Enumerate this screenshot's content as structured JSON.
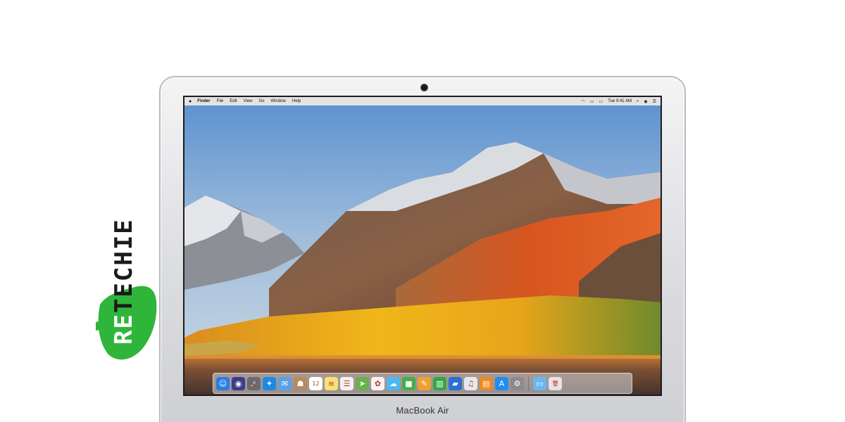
{
  "device": {
    "model_label": "MacBook Air"
  },
  "watermark": {
    "text": "RETECHIE",
    "brand_color": "#2fb53a"
  },
  "menubar": {
    "apple_icon": "apple-logo-icon",
    "items": [
      "Finder",
      "File",
      "Edit",
      "View",
      "Go",
      "Window",
      "Help"
    ],
    "status_icons": [
      "wifi-icon",
      "airplay-icon",
      "battery-icon"
    ],
    "clock": "Tue 9:41 AM",
    "right_icons": [
      "search-icon",
      "siri-icon",
      "notification-center-icon"
    ]
  },
  "dock": {
    "apps": [
      {
        "name": "finder",
        "color": "#2a7de1",
        "glyph": "☺"
      },
      {
        "name": "siri",
        "color": "#3c3c8c",
        "glyph": "◉"
      },
      {
        "name": "launchpad",
        "color": "#6a6a72",
        "glyph": "🚀"
      },
      {
        "name": "safari",
        "color": "#1e88e5",
        "glyph": "✦"
      },
      {
        "name": "mail",
        "color": "#5aa2e8",
        "glyph": "✉"
      },
      {
        "name": "contacts",
        "color": "#b38b5d",
        "glyph": "☗"
      },
      {
        "name": "calendar",
        "color": "#ffffff",
        "glyph": "12"
      },
      {
        "name": "notes",
        "color": "#f7e27a",
        "glyph": "≡"
      },
      {
        "name": "reminders",
        "color": "#f2f2f2",
        "glyph": "☰"
      },
      {
        "name": "maps",
        "color": "#6ab04c",
        "glyph": "➤"
      },
      {
        "name": "photos",
        "color": "#f5f5f5",
        "glyph": "✿"
      },
      {
        "name": "messages",
        "color": "#4cb8f0",
        "glyph": "☁"
      },
      {
        "name": "facetime",
        "color": "#3fb14c",
        "glyph": "■"
      },
      {
        "name": "pages",
        "color": "#f0a030",
        "glyph": "✎"
      },
      {
        "name": "numbers",
        "color": "#30a84a",
        "glyph": "▥"
      },
      {
        "name": "keynote",
        "color": "#2a6fd6",
        "glyph": "▰"
      },
      {
        "name": "itunes",
        "color": "#e8e8ee",
        "glyph": "♫"
      },
      {
        "name": "ibooks",
        "color": "#f08a1e",
        "glyph": "▤"
      },
      {
        "name": "app-store",
        "color": "#1e8ef0",
        "glyph": "A"
      },
      {
        "name": "system-preferences",
        "color": "#8a8a90",
        "glyph": "⚙"
      }
    ],
    "trailing": [
      {
        "name": "downloads-folder",
        "color": "#6bb6f0",
        "glyph": "▭"
      },
      {
        "name": "trash",
        "color": "#e4e4e8",
        "glyph": "🗑"
      }
    ]
  }
}
